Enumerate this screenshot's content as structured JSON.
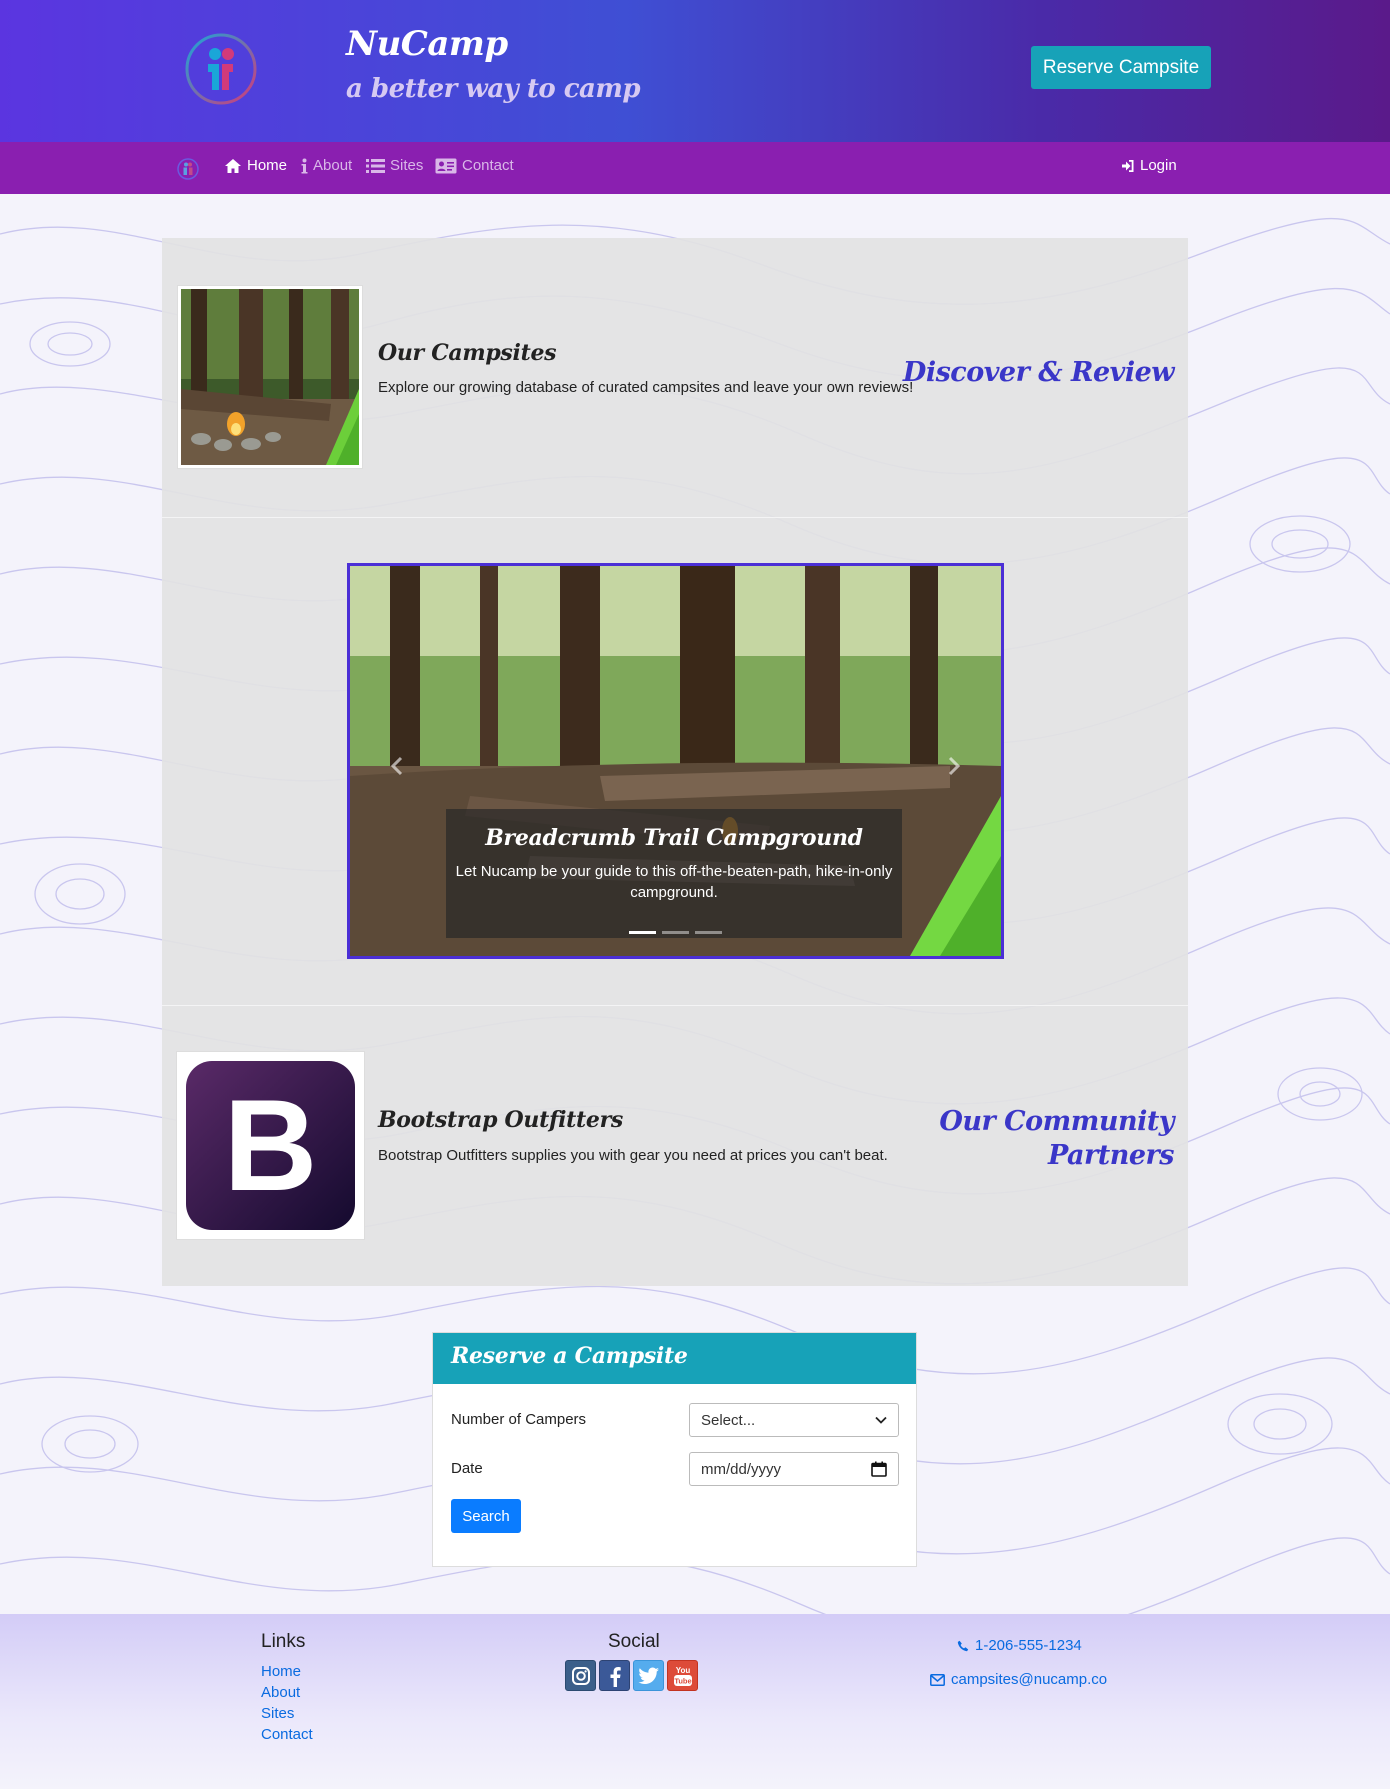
{
  "header": {
    "brand_title": "NuCamp",
    "brand_tagline": "a better way to camp",
    "reserve_button": "Reserve Campsite"
  },
  "navbar": {
    "items": [
      {
        "label": "Home",
        "icon": "home-icon",
        "active": true
      },
      {
        "label": "About",
        "icon": "info-icon",
        "active": false
      },
      {
        "label": "Sites",
        "icon": "list-icon",
        "active": false
      },
      {
        "label": "Contact",
        "icon": "address-card-icon",
        "active": false
      }
    ],
    "login": "Login"
  },
  "campsites": {
    "title": "Our Campsites",
    "text": "Explore our growing database of curated campsites and leave your own reviews!",
    "side_heading": "Discover & Review"
  },
  "carousel": {
    "caption_title": "Breadcrumb Trail Campground",
    "caption_text": "Let Nucamp be your guide to this off-the-beaten-path, hike-in-only campground.",
    "slide_count": 3,
    "active_slide": 1
  },
  "partners": {
    "title": "Bootstrap Outfitters",
    "text": "Bootstrap Outfitters supplies you with gear you need at prices you can't beat.",
    "side_heading_line1": "Our Community",
    "side_heading_line2": "Partners",
    "logo_letter": "B"
  },
  "reserve": {
    "header": "Reserve a Campsite",
    "campers_label": "Number of Campers",
    "campers_value": "Select...",
    "date_label": "Date",
    "date_placeholder": "mm/dd/yyyy",
    "search_button": "Search"
  },
  "footer": {
    "links_heading": "Links",
    "links": [
      "Home",
      "About",
      "Sites",
      "Contact"
    ],
    "social_heading": "Social",
    "social": [
      {
        "icon": "instagram-icon",
        "color": "#3b5f8a"
      },
      {
        "icon": "facebook-icon",
        "color": "#3b5998"
      },
      {
        "icon": "twitter-icon",
        "color": "#55acee"
      },
      {
        "icon": "youtube-icon",
        "color": "#dd4b39"
      }
    ],
    "phone": "1-206-555-1234",
    "email": "campsites@nucamp.co"
  },
  "colors": {
    "header_gradient_start": "#5b35e0",
    "navbar": "#8a1fb0",
    "accent": "#17a2b8",
    "heading_accent": "#3a36c8",
    "primary_button": "#0a7cff"
  }
}
